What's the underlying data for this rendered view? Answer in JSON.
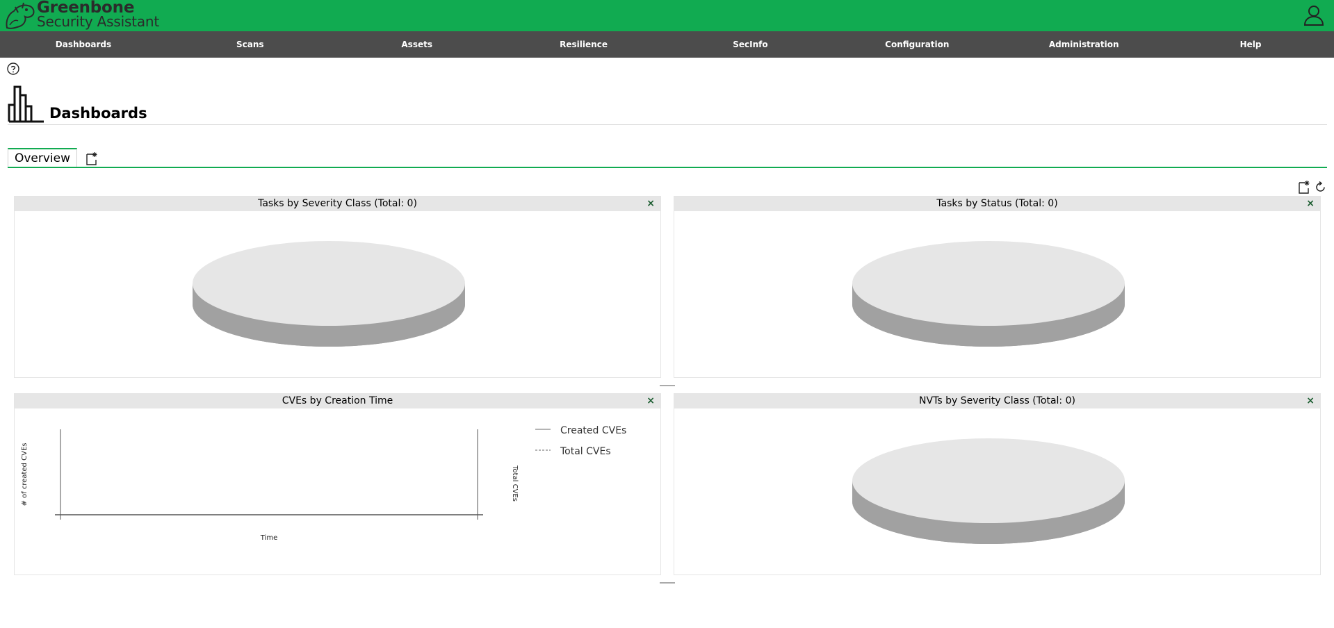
{
  "header": {
    "brand_line1": "Greenbone",
    "brand_line2": "Security Assistant",
    "logo_icon": "greenbone-dragon-logo",
    "user_icon": "user-icon",
    "colors": {
      "brand_green": "#11ab51",
      "nav_bg": "#4c4c4c"
    }
  },
  "nav": {
    "items": [
      {
        "label": "Dashboards"
      },
      {
        "label": "Scans"
      },
      {
        "label": "Assets"
      },
      {
        "label": "Resilience"
      },
      {
        "label": "SecInfo"
      },
      {
        "label": "Configuration"
      },
      {
        "label": "Administration"
      },
      {
        "label": "Help"
      }
    ]
  },
  "page": {
    "title": "Dashboards",
    "help_icon": "help-icon",
    "title_icon": "dashboard-bar-chart-icon"
  },
  "tabs": {
    "items": [
      {
        "label": "Overview"
      }
    ],
    "new_dashboard_icon": "new-dashboard-icon"
  },
  "toolbar": {
    "add_display_icon": "add-display-icon",
    "reset_icon": "reset-icon"
  },
  "displays": [
    {
      "title": "Tasks by Severity Class (Total: 0)",
      "close_label": "×",
      "chart_type": "pie-empty"
    },
    {
      "title": "Tasks by Status (Total: 0)",
      "close_label": "×",
      "chart_type": "pie-empty"
    },
    {
      "title": "CVEs by Creation Time",
      "close_label": "×",
      "chart_type": "line-empty",
      "xlabel": "Time",
      "ylabel_left": "# of created CVEs",
      "ylabel_right": "Total CVEs",
      "legend": [
        {
          "label": "Created CVEs",
          "style": "solid"
        },
        {
          "label": "Total CVEs",
          "style": "dashed"
        }
      ]
    },
    {
      "title": "NVTs by Severity Class (Total: 0)",
      "close_label": "×",
      "chart_type": "pie-empty"
    }
  ],
  "chart_data": [
    {
      "type": "pie",
      "title": "Tasks by Severity Class (Total: 0)",
      "values": []
    },
    {
      "type": "pie",
      "title": "Tasks by Status (Total: 0)",
      "values": []
    },
    {
      "type": "line",
      "title": "CVEs by Creation Time",
      "xlabel": "Time",
      "ylabel": "# of created CVEs",
      "y2label": "Total CVEs",
      "series": [
        {
          "name": "Created CVEs",
          "values": []
        },
        {
          "name": "Total CVEs",
          "values": []
        }
      ]
    },
    {
      "type": "pie",
      "title": "NVTs by Severity Class (Total: 0)",
      "values": []
    }
  ]
}
